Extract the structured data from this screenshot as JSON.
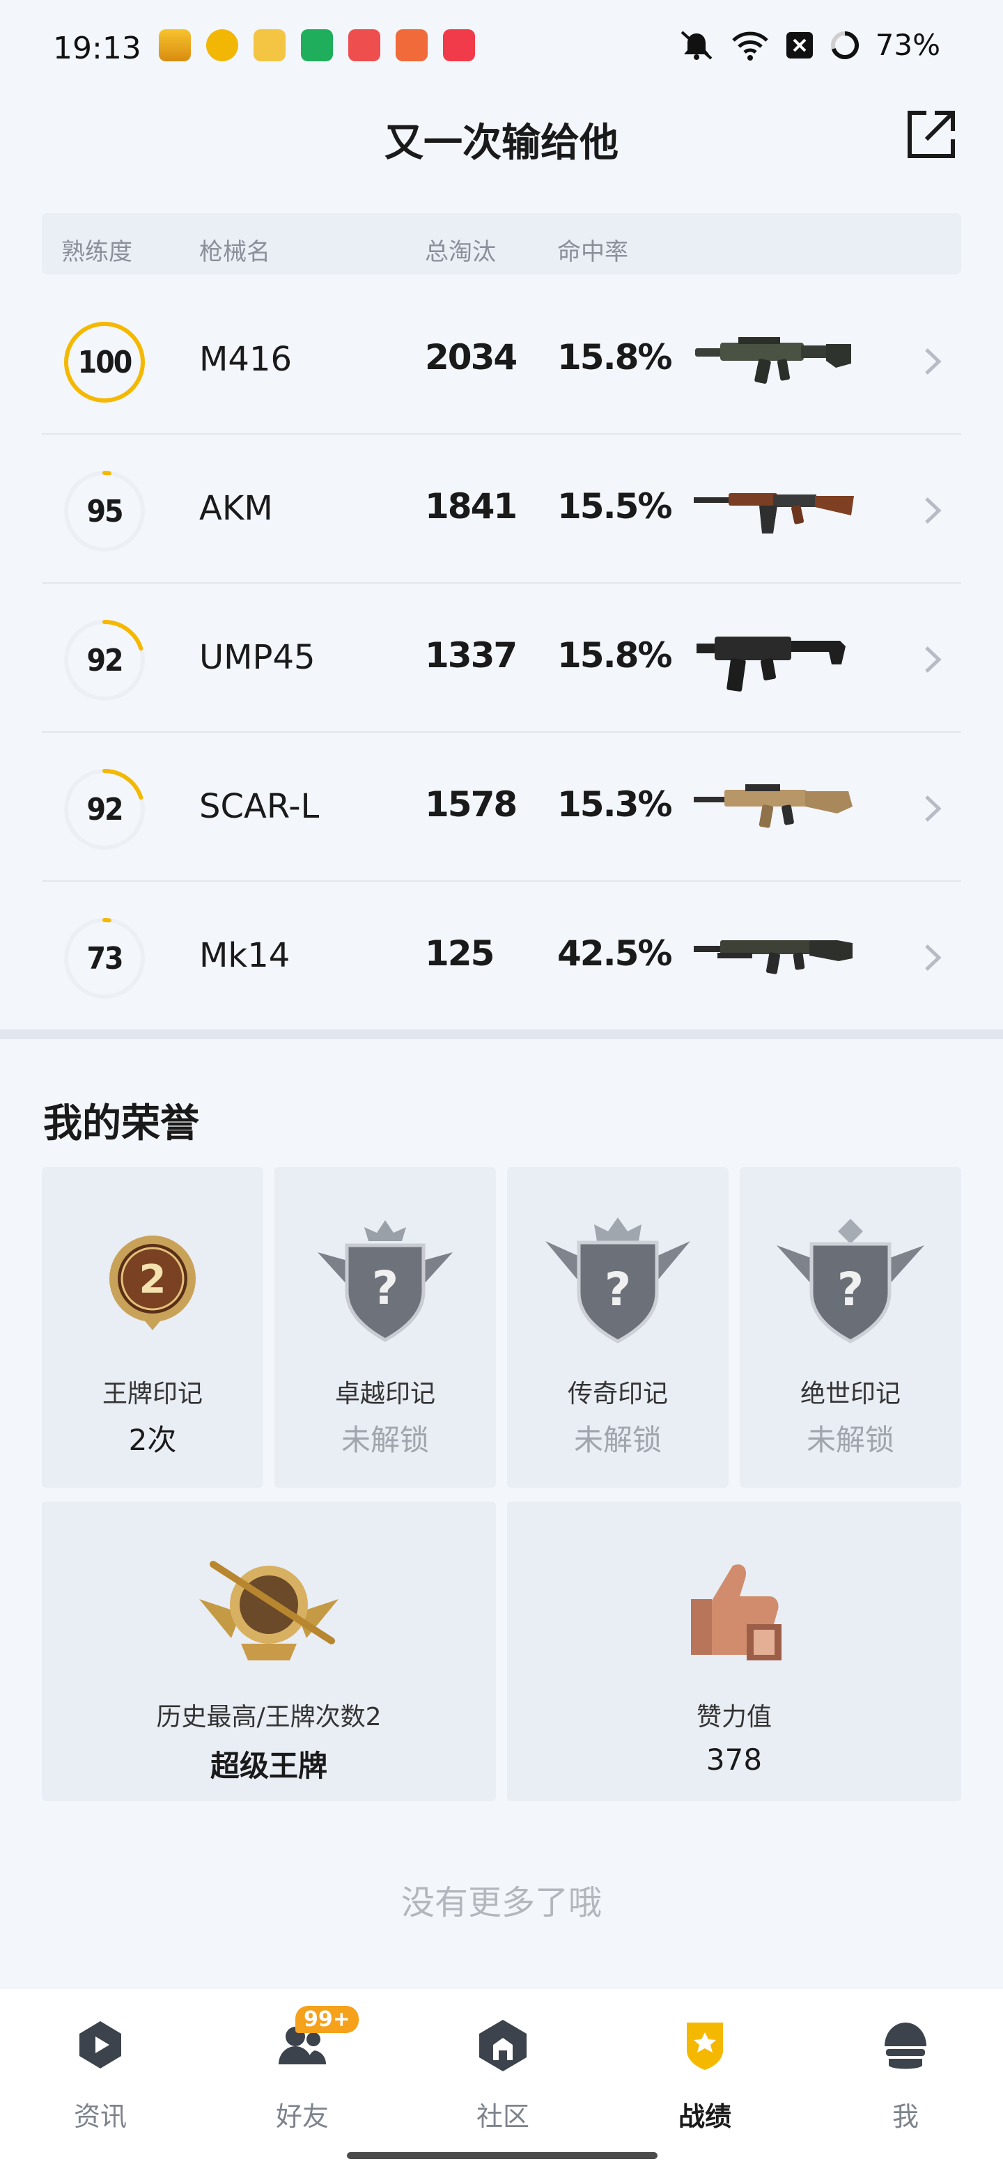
{
  "status_bar": {
    "time": "19:13",
    "battery": "73%",
    "icons": [
      "app-icon-yellow",
      "app-icon-target",
      "app-icon-book",
      "app-icon-oppo",
      "app-icon-video",
      "app-icon-red",
      "app-icon-music",
      "mute-icon",
      "wifi-icon",
      "close-box-icon",
      "battery-ring-icon"
    ]
  },
  "header": {
    "title": "又一次输给他"
  },
  "table": {
    "headers": {
      "proficiency": "熟练度",
      "gun_name": "枪械名",
      "kills": "总淘汰",
      "hit_rate": "命中率"
    },
    "rows": [
      {
        "proficiency": "100",
        "proficiency_fraction": 1.0,
        "name": "M416",
        "kills": "2034",
        "hit_rate": "15.8%"
      },
      {
        "proficiency": "95",
        "proficiency_fraction": 0.02,
        "name": "AKM",
        "kills": "1841",
        "hit_rate": "15.5%"
      },
      {
        "proficiency": "92",
        "proficiency_fraction": 0.2,
        "name": "UMP45",
        "kills": "1337",
        "hit_rate": "15.8%"
      },
      {
        "proficiency": "92",
        "proficiency_fraction": 0.2,
        "name": "SCAR-L",
        "kills": "1578",
        "hit_rate": "15.3%"
      },
      {
        "proficiency": "73",
        "proficiency_fraction": 0.02,
        "name": "Mk14",
        "kills": "125",
        "hit_rate": "42.5%"
      }
    ]
  },
  "honors": {
    "title": "我的荣誉",
    "small_cards": [
      {
        "label": "王牌印记",
        "value": "2次",
        "emblem_text": "2",
        "locked": false
      },
      {
        "label": "卓越印记",
        "value": "未解锁",
        "emblem_text": "?",
        "locked": true
      },
      {
        "label": "传奇印记",
        "value": "未解锁",
        "emblem_text": "?",
        "locked": true
      },
      {
        "label": "绝世印记",
        "value": "未解锁",
        "emblem_text": "?",
        "locked": true
      }
    ],
    "big_cards": [
      {
        "label": "历史最高/王牌次数2",
        "value": "超级王牌"
      },
      {
        "label": "赞力值",
        "value": "378"
      }
    ]
  },
  "footer_text": "没有更多了哦",
  "bottom_nav": {
    "items": [
      {
        "label": "资讯",
        "icon": "news-icon"
      },
      {
        "label": "好友",
        "icon": "friends-icon",
        "badge": "99+"
      },
      {
        "label": "社区",
        "icon": "community-icon"
      },
      {
        "label": "战绩",
        "icon": "record-icon",
        "active": true
      },
      {
        "label": "我",
        "icon": "profile-icon"
      }
    ]
  },
  "colors": {
    "accent": "#f5b800",
    "ring_track": "#eceff4",
    "badge": "#f5a11c"
  }
}
